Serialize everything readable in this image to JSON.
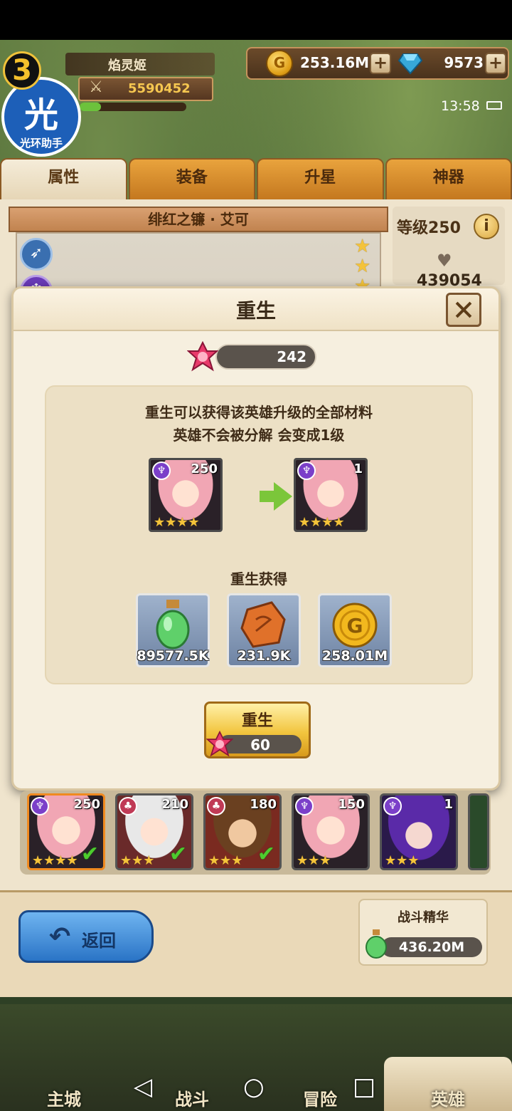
{
  "hud": {
    "vip_level": "3",
    "assistant_badge_big": "光",
    "assistant_badge_small": "光环助手",
    "player_name": "焰灵姬",
    "power": "5590452",
    "gold": "253.16M",
    "gems": "9573",
    "time": "13:58",
    "exp_fraction": 0.2
  },
  "tabs": [
    {
      "label": "属性",
      "active": true
    },
    {
      "label": "装备",
      "active": false
    },
    {
      "label": "升星",
      "active": false
    },
    {
      "label": "神器",
      "active": false
    }
  ],
  "hero": {
    "name": "绯红之镰 · 艾可",
    "level_label": "等级250",
    "hp": "439054"
  },
  "dialog": {
    "title": "重生",
    "stone_count": "242",
    "desc_line1": "重生可以获得该英雄升级的全部材料",
    "desc_line2": "英雄不会被分解 会变成1级",
    "before_level": "250",
    "after_level": "1",
    "reward_title": "重生获得",
    "rewards": [
      {
        "icon": "potion-icon",
        "amount": "89577.5K"
      },
      {
        "icon": "ore-icon",
        "amount": "231.9K"
      },
      {
        "icon": "gold-coin-icon",
        "amount": "258.01M"
      }
    ],
    "rebirth_button": "重生",
    "rebirth_cost": "60"
  },
  "hero_list": [
    {
      "level": "250",
      "stars": "★★★★",
      "checked": true,
      "selected": true
    },
    {
      "level": "210",
      "stars": "★★★",
      "checked": true,
      "selected": false
    },
    {
      "level": "180",
      "stars": "★★★",
      "checked": true,
      "selected": false
    },
    {
      "level": "150",
      "stars": "★★★",
      "checked": false,
      "selected": false
    },
    {
      "level": "1",
      "stars": "★★★",
      "checked": false,
      "selected": false
    }
  ],
  "bottom": {
    "back_label": "返回",
    "essence_title": "战斗精华",
    "essence_value": "436.20M"
  },
  "nav": [
    {
      "label": "主城"
    },
    {
      "label": "战斗"
    },
    {
      "label": "冒险"
    },
    {
      "label": "英雄"
    }
  ]
}
